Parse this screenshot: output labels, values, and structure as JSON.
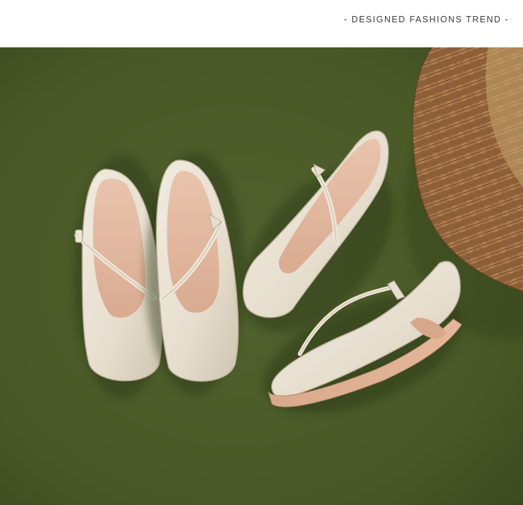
{
  "header": {
    "tagline": "- DESIGNED FASHIONS TREND -"
  },
  "photo": {
    "subject": "product-photo-mary-jane-shoes",
    "colors": {
      "background_green": "#4a5a29",
      "shoe_cream": "#e9e1d3",
      "insole_tan": "#e3b9a1",
      "sole_tan": "#d7a384",
      "basket_brown": "#9a6a41"
    }
  }
}
